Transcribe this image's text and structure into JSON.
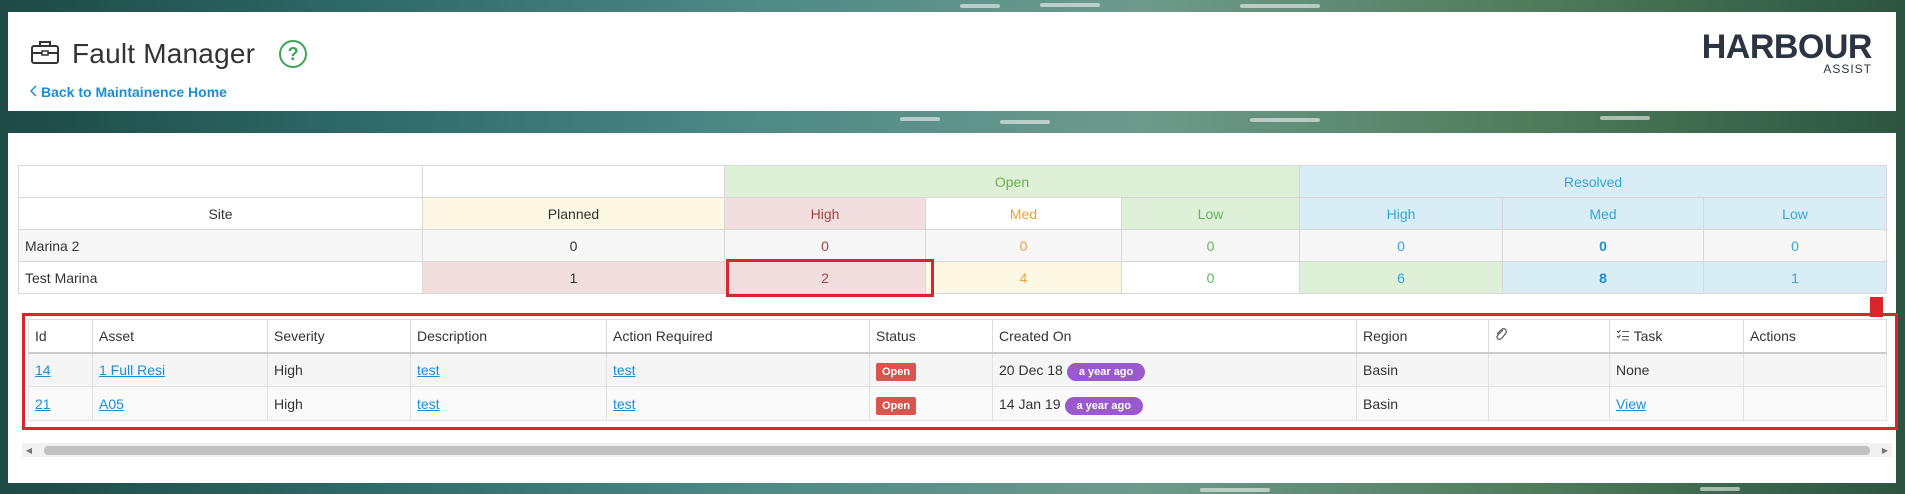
{
  "header": {
    "title": "Fault Manager",
    "help_symbol": "?",
    "back_link": "Back to Maintainence Home",
    "logo_main": "HARBOUR",
    "logo_sub": "ASSIST",
    "icons": {
      "title_icon": "briefcase-icon",
      "help_icon": "help-circle-icon",
      "back_icon": "chevron-left-icon"
    }
  },
  "summary": {
    "group_open": "Open",
    "group_resolved": "Resolved",
    "headers": [
      "Site",
      "Planned",
      "High",
      "Med",
      "Low",
      "High",
      "Med",
      "Low"
    ],
    "rows": [
      {
        "site": "Marina 2",
        "values": [
          "0",
          "0",
          "0",
          "0",
          "0",
          "0",
          "0"
        ]
      },
      {
        "site": "Test Marina",
        "values": [
          "1",
          "2",
          "4",
          "0",
          "6",
          "8",
          "1"
        ]
      }
    ]
  },
  "faults": {
    "columns": [
      "Id",
      "Asset",
      "Severity",
      "Description",
      "Action Required",
      "Status",
      "Created On",
      "Region",
      "",
      "Task",
      "Actions"
    ],
    "column_icons": {
      "attachment": "paperclip-icon",
      "task": "checklist-icon"
    },
    "rows": [
      {
        "id": "14",
        "asset": "1 Full Resi",
        "severity": "High",
        "description": "test",
        "action": "test",
        "status": "Open",
        "created": "20 Dec 18",
        "ago": "a year ago",
        "region": "Basin",
        "attachment": "",
        "task": "None",
        "actions": ""
      },
      {
        "id": "21",
        "asset": "A05",
        "severity": "High",
        "description": "test",
        "action": "test",
        "status": "Open",
        "created": "14 Jan 19",
        "ago": "a year ago",
        "region": "Basin",
        "attachment": "",
        "task": "View",
        "actions": ""
      }
    ]
  },
  "colors": {
    "accent": "#1a8fd6",
    "open_badge": "#d9534f",
    "ago_badge": "#9b59d0",
    "highlight": "#d9262a"
  }
}
